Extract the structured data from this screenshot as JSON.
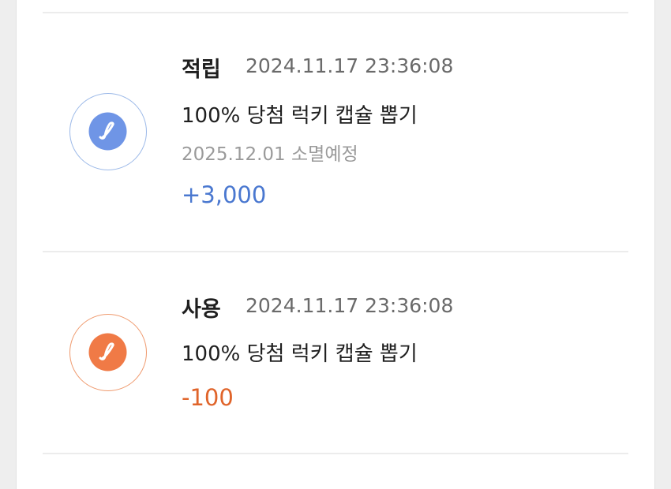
{
  "transactions": [
    {
      "type_label": "적립",
      "timestamp": "2024.11.17 23:36:08",
      "title": "100% 당첨 럭키 캡슐 뽑기",
      "expiry": "2025.12.01 소멸예정",
      "amount": "+3,000",
      "icon": "capsule-icon",
      "color": "#4a78d0",
      "ring_color": "#9cb9e8",
      "fill_color": "#6f95e6"
    },
    {
      "type_label": "사용",
      "timestamp": "2024.11.17 23:36:08",
      "title": "100% 당첨 럭키 캡슐 뽑기",
      "amount": "-100",
      "icon": "capsule-icon",
      "color": "#e0642a",
      "ring_color": "#ef9a6e",
      "fill_color": "#f07a46"
    }
  ]
}
